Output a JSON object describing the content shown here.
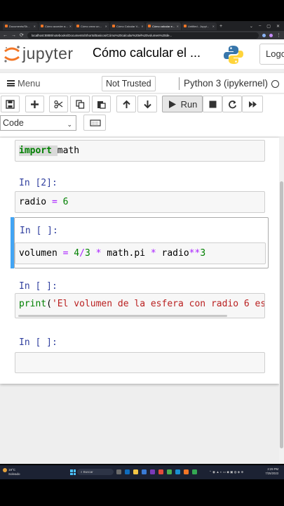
{
  "browser": {
    "tabs": [
      {
        "label": "Documents/Sh..."
      },
      {
        "label": "Cómo acceder a..."
      },
      {
        "label": "Cómo crear un..."
      },
      {
        "label": "Cómo Calcular V..."
      },
      {
        "label": "Cómo calcular e..."
      },
      {
        "label": "Untitled - Jupyt..."
      }
    ],
    "url": "localhost:8888/notebooks/Documents/Shorts/Basicos/Cómo%20calcular%20el%20volumen%20de..."
  },
  "header": {
    "logo_text": "jupyter",
    "notebook_title": "Cómo calcular el ...",
    "logout_label": "Logo"
  },
  "menubar": {
    "menu_label": "Menu",
    "trust_label": "Not Trusted",
    "kernel_name": "Python 3 (ipykernel)"
  },
  "toolbar": {
    "run_label": "Run",
    "cell_type": "Code"
  },
  "cells": [
    {
      "prompt": "",
      "code": "import math"
    },
    {
      "prompt": "In [2]:",
      "code": "radio = 6"
    },
    {
      "prompt": "In [ ]:",
      "code": "volumen = 4/3 * math.pi * radio**3"
    },
    {
      "prompt": "In [ ]:",
      "code": "print('El volumen de la esfera con radio 6 es"
    },
    {
      "prompt": "In [ ]:",
      "code": ""
    }
  ],
  "taskbar": {
    "weather_temp": "19°C",
    "weather_desc": "Soleado",
    "search_label": "Buscar",
    "time": "2:29 PM",
    "date": "7/25/2023"
  },
  "colors": {
    "prompt": "#303f9f",
    "keyword": "#008000",
    "operator": "#aa22ff",
    "string": "#ba2121",
    "selected_bar": "#42a5f5",
    "jupyter_orange": "#f37626"
  }
}
